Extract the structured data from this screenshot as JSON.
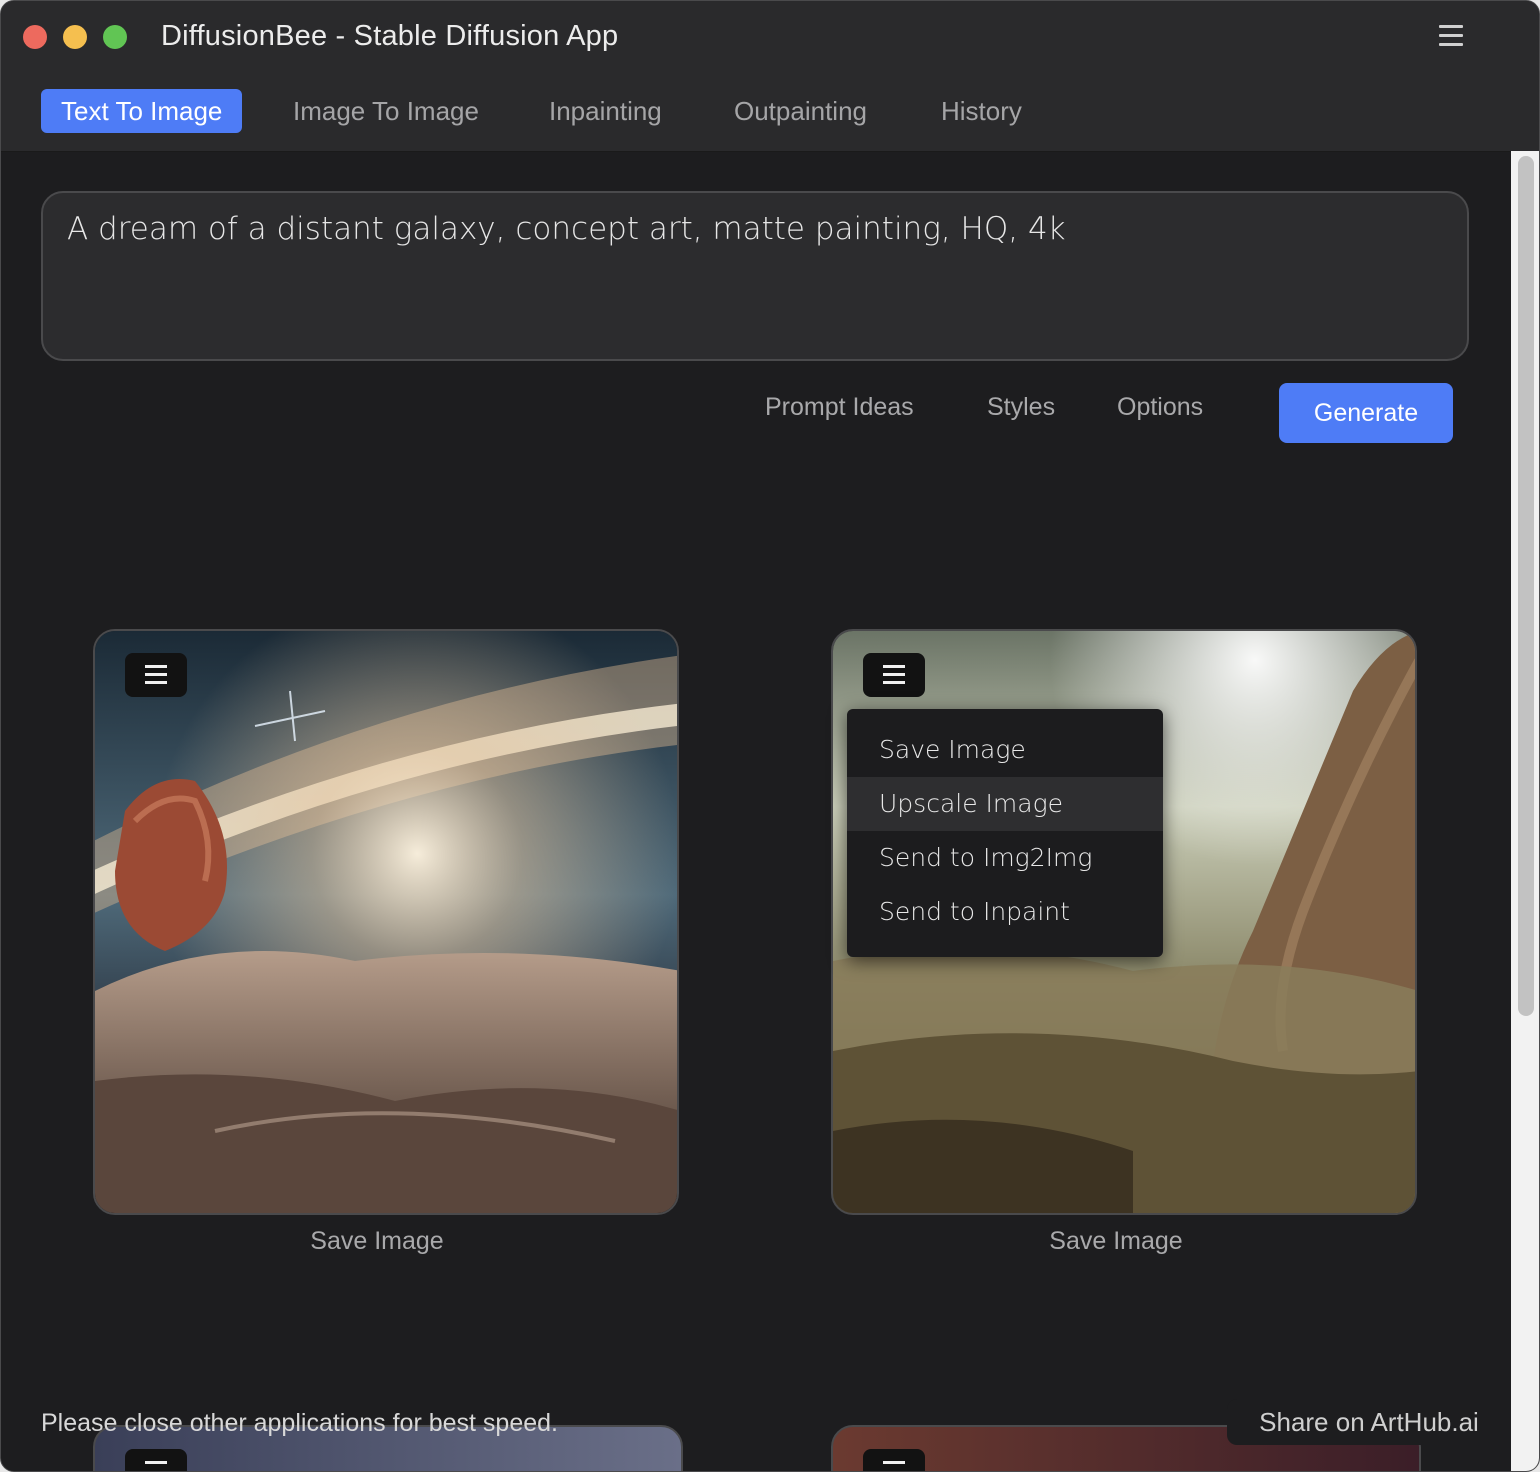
{
  "window": {
    "title": "DiffusionBee - Stable Diffusion App"
  },
  "tabs": [
    {
      "label": "Text To Image",
      "active": true
    },
    {
      "label": "Image To Image",
      "active": false
    },
    {
      "label": "Inpainting",
      "active": false
    },
    {
      "label": "Outpainting",
      "active": false
    },
    {
      "label": "History",
      "active": false
    }
  ],
  "prompt": {
    "value": "A dream of a distant galaxy, concept art, matte painting, HQ, 4k"
  },
  "actions": {
    "prompt_ideas": "Prompt Ideas",
    "styles": "Styles",
    "options": "Options",
    "generate": "Generate"
  },
  "images": [
    {
      "save_label": "Save Image"
    },
    {
      "save_label": "Save Image"
    }
  ],
  "image_menu": {
    "items": [
      "Save Image",
      "Upscale Image",
      "Send to Img2Img",
      "Send to Inpaint"
    ],
    "highlighted_index": 1
  },
  "footer": {
    "note": "Please close other applications for best speed.",
    "share": "Share on ArtHub.ai"
  },
  "colors": {
    "accent": "#4e7cf6",
    "background": "#1d1d1f",
    "panel": "#2a2a2c"
  }
}
